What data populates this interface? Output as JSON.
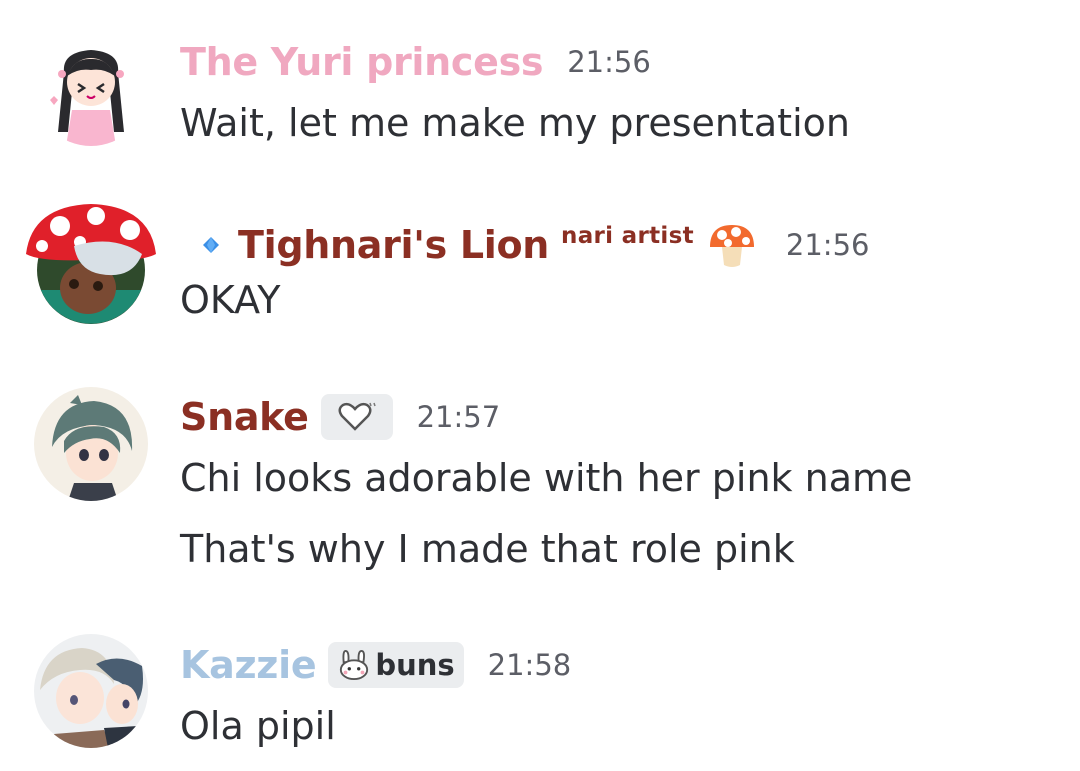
{
  "colors": {
    "yuri_name": "#f0a8c0",
    "tighnari_name": "#8b2f23",
    "snake_name": "#8b2f23",
    "kazzie_name": "#a7c4e0",
    "timestamp": "#5c5e66",
    "text": "#2e3035"
  },
  "messages": [
    {
      "username": "The Yuri princess",
      "timestamp": "21:56",
      "lines": [
        "Wait, let me make my presentation"
      ],
      "avatar_icon": "avatar-anime-girl-pink"
    },
    {
      "username": "Tighnari's Lion",
      "role_icon": "blue-diamond-icon",
      "tag": "nari artist",
      "emoji": "mushroom-emoji",
      "timestamp": "21:56",
      "lines": [
        "OKAY"
      ],
      "avatar_icon": "avatar-mushroom-hat"
    },
    {
      "username": "Snake",
      "server_tag_icon": "heart-badge-icon",
      "timestamp": "21:57",
      "lines": [
        "Chi looks adorable with her pink name",
        "That's why I made that role pink"
      ],
      "avatar_icon": "avatar-green-hair"
    },
    {
      "username": "Kazzie",
      "server_tag_icon": "bunny-icon",
      "server_tag_text": "buns",
      "timestamp": "21:58",
      "lines": [
        "Ola pipil"
      ],
      "avatar_icon": "avatar-two-characters"
    }
  ]
}
